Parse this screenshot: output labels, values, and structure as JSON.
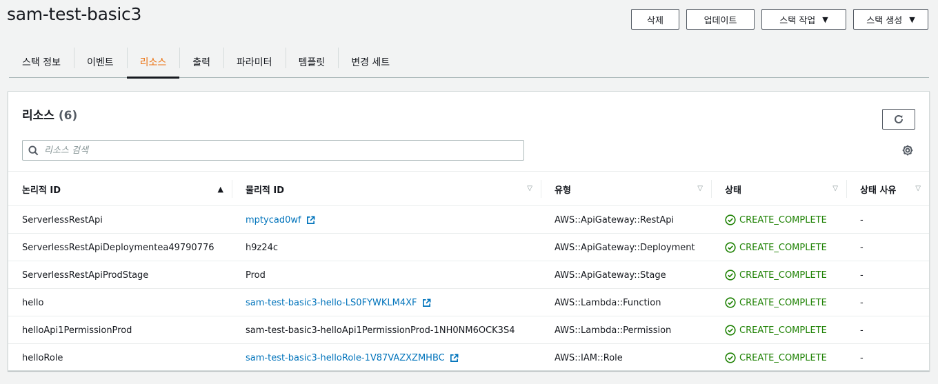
{
  "header": {
    "title": "sam-test-basic3"
  },
  "actions": {
    "delete": "삭제",
    "update": "업데이트",
    "stack_actions": "스택 작업",
    "create_stack": "스택 생성"
  },
  "tabs": [
    {
      "label": "스택 정보"
    },
    {
      "label": "이벤트"
    },
    {
      "label": "리소스"
    },
    {
      "label": "출력"
    },
    {
      "label": "파라미터"
    },
    {
      "label": "템플릿"
    },
    {
      "label": "변경 세트"
    }
  ],
  "panel": {
    "title": "리소스",
    "count": "(6)",
    "search_placeholder": "리소스 검색"
  },
  "table": {
    "columns": [
      "논리적 ID",
      "물리적 ID",
      "유형",
      "상태",
      "상태 사유"
    ],
    "rows": [
      {
        "logical": "ServerlessRestApi",
        "physical": "mptycad0wf",
        "type": "AWS::ApiGateway::RestApi",
        "status": "CREATE_COMPLETE",
        "reason": "-"
      },
      {
        "logical": "ServerlessRestApiDeploymentea49790776",
        "physical": "h9z24c",
        "type": "AWS::ApiGateway::Deployment",
        "status": "CREATE_COMPLETE",
        "reason": "-"
      },
      {
        "logical": "ServerlessRestApiProdStage",
        "physical": "Prod",
        "type": "AWS::ApiGateway::Stage",
        "status": "CREATE_COMPLETE",
        "reason": "-"
      },
      {
        "logical": "hello",
        "physical": "sam-test-basic3-hello-LS0FYWKLM4XF",
        "type": "AWS::Lambda::Function",
        "status": "CREATE_COMPLETE",
        "reason": "-"
      },
      {
        "logical": "helloApi1PermissionProd",
        "physical": "sam-test-basic3-helloApi1PermissionProd-1NH0NM6OCK3S4",
        "type": "AWS::Lambda::Permission",
        "status": "CREATE_COMPLETE",
        "reason": "-"
      },
      {
        "logical": "helloRole",
        "physical": "sam-test-basic3-helloRole-1V87VAZXZMHBC",
        "type": "AWS::IAM::Role",
        "status": "CREATE_COMPLETE",
        "reason": "-"
      }
    ]
  },
  "colors": {
    "accent_tab": "#ec7211",
    "link": "#0073bb",
    "success": "#1d8102"
  },
  "icons": {
    "search": "search-icon",
    "refresh": "refresh-icon",
    "settings": "gear-icon",
    "external": "external-link-icon",
    "status_ok": "check-circle-icon",
    "sort_asc": "caret-up-icon",
    "sort_none": "caret-down-icon",
    "dropdown": "caret-down-icon"
  }
}
